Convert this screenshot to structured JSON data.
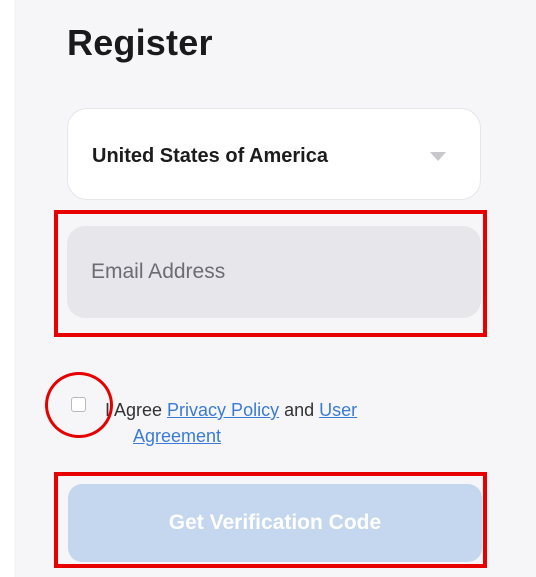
{
  "title": "Register",
  "country": {
    "selected": "United States of America",
    "caret_icon": "caret-down-icon"
  },
  "email": {
    "placeholder": "Email Address"
  },
  "agreement": {
    "checked": false,
    "prefix": "I Agree ",
    "privacy_link": "Privacy Policy",
    "conjunction": " and ",
    "user_link_part1": "User",
    "user_link_part2": "Agreement"
  },
  "verify_button": {
    "label": "Get Verification Code"
  },
  "colors": {
    "highlight": "#e60000",
    "link": "#3b7bd4",
    "button_disabled": "#c4d7ef",
    "field_bg": "#e6e6eb"
  }
}
